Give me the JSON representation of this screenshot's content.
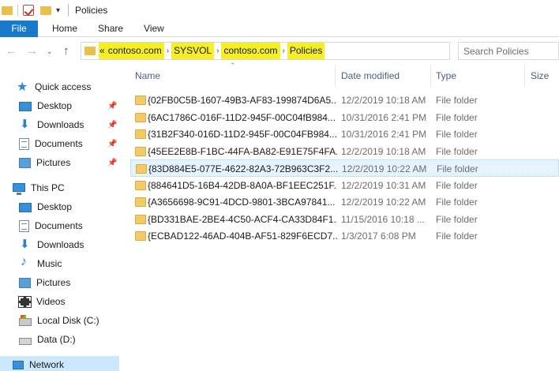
{
  "window": {
    "title": "Policies"
  },
  "ribbon": {
    "file": "File",
    "tabs": [
      "Home",
      "Share",
      "View"
    ]
  },
  "address": {
    "overflow": "«",
    "segments": [
      "contoso.com",
      "SYSVOL",
      "contoso.com",
      "Policies"
    ],
    "highlight_color": "#f7ef25"
  },
  "search": {
    "placeholder": "Search Policies"
  },
  "sidebar": {
    "quick_access": "Quick access",
    "quick_items": [
      "Desktop",
      "Downloads",
      "Documents",
      "Pictures"
    ],
    "this_pc": "This PC",
    "pc_items": [
      "Desktop",
      "Documents",
      "Downloads",
      "Music",
      "Pictures",
      "Videos",
      "Local Disk (C:)",
      "Data (D:)"
    ],
    "network": "Network"
  },
  "columns": {
    "name": "Name",
    "date": "Date modified",
    "type": "Type",
    "size": "Size"
  },
  "files": [
    {
      "name": "{02FB0C5B-1607-49B3-AF83-199874D6A5...",
      "date": "12/2/2019 10:18 AM",
      "type": "File folder"
    },
    {
      "name": "{6AC1786C-016F-11D2-945F-00C04fB984...",
      "date": "10/31/2016 2:41 PM",
      "type": "File folder"
    },
    {
      "name": "{31B2F340-016D-11D2-945F-00C04FB984...",
      "date": "10/31/2016 2:41 PM",
      "type": "File folder"
    },
    {
      "name": "{45EE2E8B-F1BC-44FA-BA82-E91E75F4FA...",
      "date": "12/2/2019 10:18 AM",
      "type": "File folder"
    },
    {
      "name": "{83D884E5-077E-4622-82A3-72B963C3F2...",
      "date": "12/2/2019 10:22 AM",
      "type": "File folder"
    },
    {
      "name": "{884641D5-16B4-42DB-8A0A-BF1EEC251F...",
      "date": "12/2/2019 10:31 AM",
      "type": "File folder"
    },
    {
      "name": "{A3656698-9C91-4DCD-9801-3BCA97841...",
      "date": "12/2/2019 10:22 AM",
      "type": "File folder"
    },
    {
      "name": "{BD331BAE-2BE4-4C50-ACF4-CA33D84F1...",
      "date": "11/15/2016 10:18 ...",
      "type": "File folder"
    },
    {
      "name": "{ECBAD122-46AD-404B-AF51-829F6ECD7...",
      "date": "1/3/2017 6:08 PM",
      "type": "File folder"
    }
  ]
}
